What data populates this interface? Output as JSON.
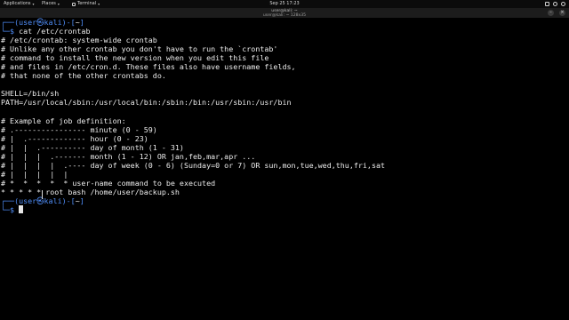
{
  "topbar": {
    "applications": "Applications",
    "places": "Places",
    "terminal": "Terminal",
    "clock": "Sep 25  17:23"
  },
  "window": {
    "title": "user@kali: ~",
    "subtitle": "user@kali: ~ 128x35"
  },
  "terminal": {
    "prompt1": {
      "open": "┌──(",
      "userhost": "user㉿kali",
      "close": ")-[",
      "path": "~",
      "end": "]"
    },
    "cmd1": {
      "prefix": "└─",
      "dollar": "$ ",
      "command": "cat /etc/crontab"
    },
    "output": [
      "# /etc/crontab: system-wide crontab",
      "# Unlike any other crontab you don't have to run the `crontab'",
      "# command to install the new version when you edit this file",
      "# and files in /etc/cron.d. These files also have username fields,",
      "# that none of the other crontabs do.",
      "",
      "SHELL=/bin/sh",
      "PATH=/usr/local/sbin:/usr/local/bin:/sbin:/bin:/usr/sbin:/usr/bin",
      "",
      "# Example of job definition:",
      "# .---------------- minute (0 - 59)",
      "# |  .------------- hour (0 - 23)",
      "# |  |  .---------- day of month (1 - 31)",
      "# |  |  |  .------- month (1 - 12) OR jan,feb,mar,apr ...",
      "# |  |  |  |  .---- day of week (0 - 6) (Sunday=0 or 7) OR sun,mon,tue,wed,thu,fri,sat",
      "# |  |  |  |  |",
      "# *  *  *  *  * user-name command to be executed",
      "* * * * * root bash /home/user/backup.sh"
    ],
    "prompt2": {
      "open": "┌──(",
      "userhost": "user㉿kali",
      "close": ")-[",
      "path": "~",
      "end": "]"
    },
    "cmd2": {
      "prefix": "└─",
      "dollar": "$ ",
      "command": ""
    }
  }
}
